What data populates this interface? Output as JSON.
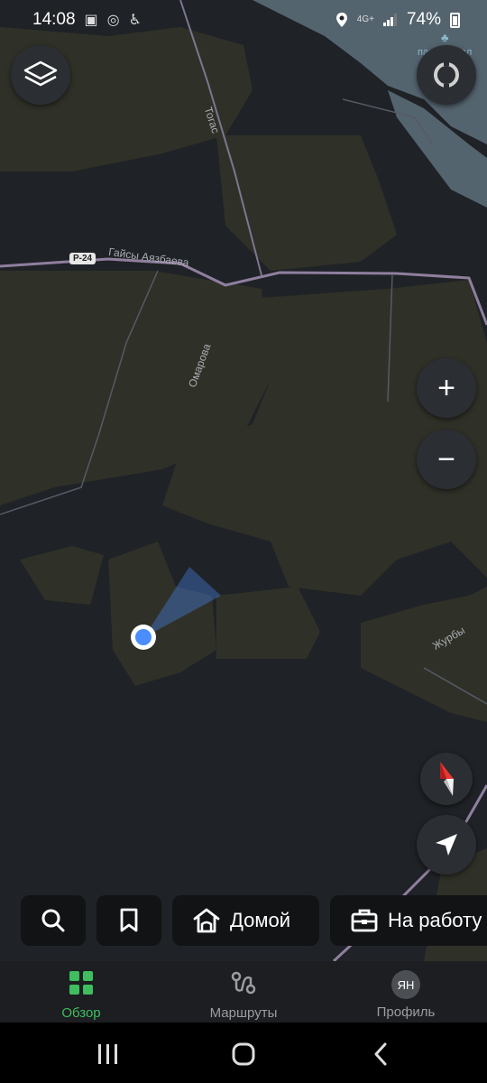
{
  "status_bar": {
    "time": "14:08",
    "network": "4G+",
    "battery": "74%",
    "icons": [
      "gallery-icon",
      "headset-icon",
      "accessibility-icon",
      "location-icon",
      "signal-icon",
      "battery-icon"
    ]
  },
  "map": {
    "labels": {
      "road_main": "Гайсы Аязбаева",
      "road_shield": "Р-24",
      "street_togas": "Тогас",
      "street_omarova": "Омарова",
      "street_zhurby": "Журбы",
      "poi_park": "парк Самал"
    },
    "colors": {
      "background": "#1f2226",
      "urban_area": "#2f3128",
      "water": "#54646f",
      "main_road": "#8f7f9f",
      "my_location": "#4a8dff"
    }
  },
  "controls": {
    "layers": "layers-icon",
    "compass_ring": "rotation-icon",
    "zoom_in": "+",
    "zoom_out": "−",
    "compass": "compass-icon",
    "my_location": "navigation-arrow-icon"
  },
  "quick_actions": {
    "search": "search-icon",
    "bookmarks": "bookmark-icon",
    "home_label": "Домой",
    "work_label": "На работу"
  },
  "bottom_nav": {
    "overview": "Обзор",
    "routes": "Маршруты",
    "profile": "Профиль",
    "avatar_initials": "ЯН",
    "active": "overview",
    "accent": "#3fbd5f"
  },
  "android_nav": [
    "recents-icon",
    "home-icon",
    "back-icon"
  ]
}
